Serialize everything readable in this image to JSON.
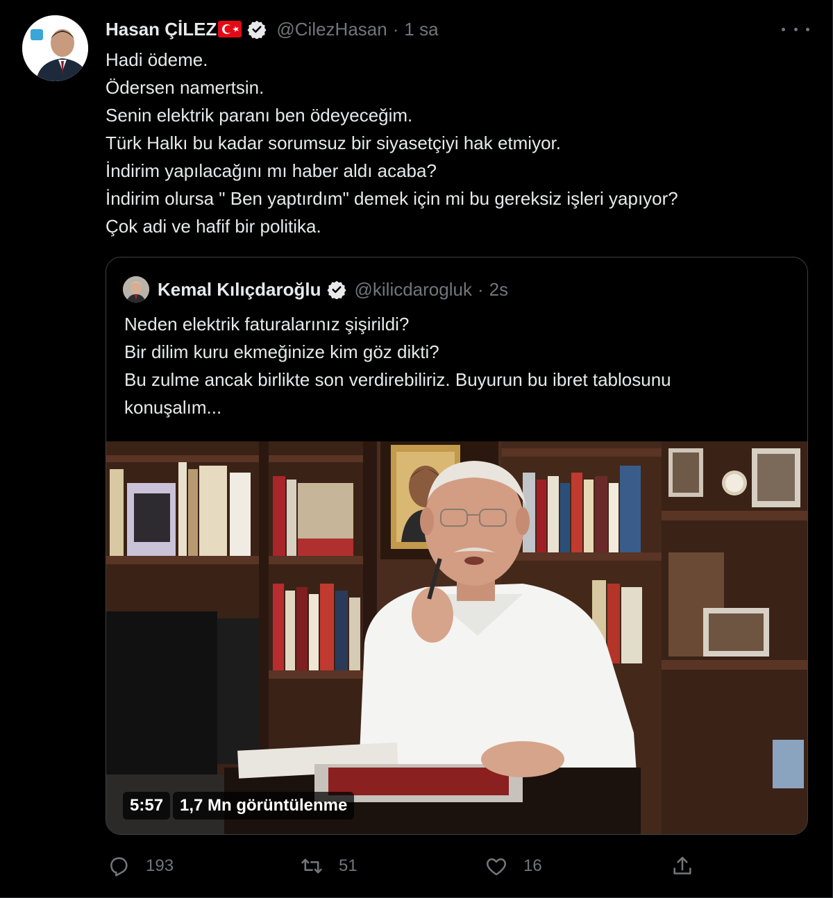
{
  "tweet": {
    "author_name": "Hasan ÇİLEZ",
    "handle": "@CilezHasan",
    "separator": "·",
    "time": "1 sa",
    "lines": [
      "Hadi ödeme.",
      "Ödersen namertsin.",
      "Senin elektrik paranı ben ödeyeceğim.",
      "Türk Halkı bu kadar sorumsuz bir siyasetçiyi hak etmiyor.",
      "İndirim yapılacağını mı haber aldı acaba?",
      "İndirim olursa \" Ben yaptırdım\" demek için mi bu gereksiz işleri yapıyor?",
      "Çok adi ve hafif bir politika."
    ]
  },
  "quote": {
    "author_name": "Kemal Kılıçdaroğlu",
    "handle": "@kilicdarogluk",
    "separator": "·",
    "time": "2s",
    "lines": [
      "Neden elektrik faturalarınız şişirildi?",
      "Bir dilim kuru ekmeğinize kim göz dikti?",
      "Bu zulme ancak birlikte son verdirebiliriz. Buyurun bu ibret tablosunu",
      "konuşalım..."
    ],
    "video": {
      "duration": "5:57",
      "views": "1,7 Mn görüntülenme"
    }
  },
  "actions": {
    "reply_count": "193",
    "retweet_count": "51",
    "like_count": "16"
  },
  "colors": {
    "background": "#000000",
    "text": "#e7e9ea",
    "muted": "#71767b",
    "border": "#3d4246",
    "verified": "#e7e9ea"
  },
  "icons": [
    "more-icon",
    "verified-icon",
    "turkey-flag-icon",
    "reply-icon",
    "retweet-icon",
    "like-icon",
    "share-icon"
  ]
}
